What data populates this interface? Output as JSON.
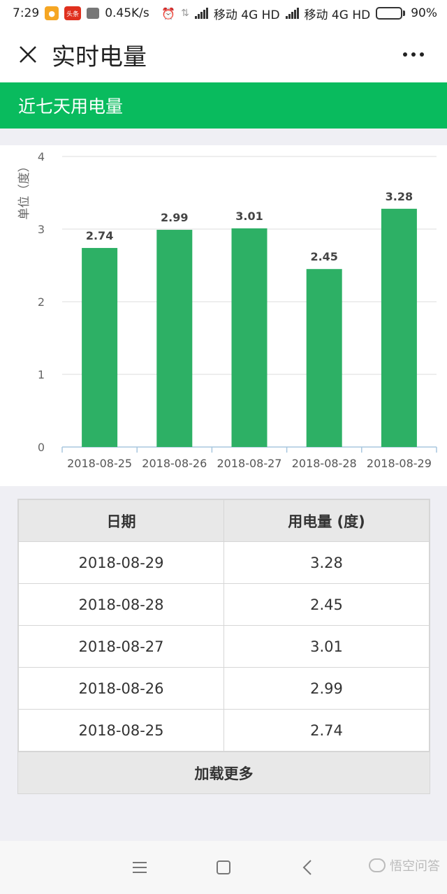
{
  "status_bar": {
    "time": "7:29",
    "speed": "0.45K/s",
    "carrier1": "移动 4G HD",
    "carrier2": "移动 4G HD",
    "battery": "90%",
    "battery_level": 0.9,
    "red_chip": "头条"
  },
  "header": {
    "title": "实时电量"
  },
  "banner": {
    "title": "近七天用电量"
  },
  "chart_data": {
    "type": "bar",
    "categories": [
      "2018-08-25",
      "2018-08-26",
      "2018-08-27",
      "2018-08-28",
      "2018-08-29"
    ],
    "values": [
      2.74,
      2.99,
      3.01,
      2.45,
      3.28
    ],
    "value_labels": [
      "2.74",
      "2.99",
      "3.01",
      "2.45",
      "3.28"
    ],
    "ylabel": "单位（度）",
    "yticks": [
      "0",
      "1",
      "2",
      "3",
      "4"
    ],
    "ylim": [
      0,
      4
    ],
    "grid": true,
    "bar_color": "#2db065"
  },
  "table": {
    "headers": [
      "日期",
      "用电量 (度)"
    ],
    "rows": [
      [
        "2018-08-29",
        "3.28"
      ],
      [
        "2018-08-28",
        "2.45"
      ],
      [
        "2018-08-27",
        "3.01"
      ],
      [
        "2018-08-26",
        "2.99"
      ],
      [
        "2018-08-25",
        "2.74"
      ]
    ],
    "load_more": "加载更多"
  },
  "watermark": {
    "text": "悟空问答"
  },
  "colors": {
    "accent": "#09bb5e"
  }
}
